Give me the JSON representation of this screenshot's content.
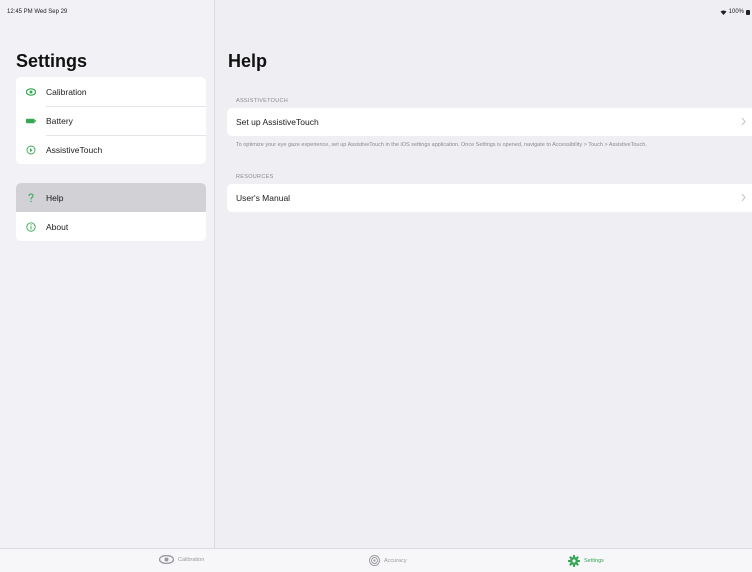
{
  "status_bar": {
    "time": "12:45 PM  Wed Sep 29",
    "battery": "100%"
  },
  "sidebar": {
    "title": "Settings",
    "group1": [
      {
        "label": "Calibration",
        "icon": "eye-icon"
      },
      {
        "label": "Battery",
        "icon": "battery-icon"
      },
      {
        "label": "AssistiveTouch",
        "icon": "assistivetouch-icon"
      }
    ],
    "group2": [
      {
        "label": "Help",
        "icon": "question-icon",
        "selected": true
      },
      {
        "label": "About",
        "icon": "info-icon"
      }
    ]
  },
  "detail": {
    "title": "Help",
    "section1": {
      "header": "ASSISTIVETOUCH",
      "cell": "Set up AssistiveTouch",
      "footer": "To optimize your eye gaze experience, set up AssistiveTouch in the iOS settings application. Once Settings is opened, navigate to Accessibility > Touch > AssistiveTouch."
    },
    "section2": {
      "header": "RESOURCES",
      "cell": "User's Manual"
    }
  },
  "tab_bar": [
    {
      "label": "Calibration",
      "icon": "eye-icon"
    },
    {
      "label": "Accuracy",
      "icon": "target-icon"
    },
    {
      "label": "Settings",
      "icon": "gear-icon",
      "active": true
    }
  ],
  "colors": {
    "accent": "#34a853",
    "selected_row": "#d1d1d6",
    "background": "#efeff3"
  }
}
